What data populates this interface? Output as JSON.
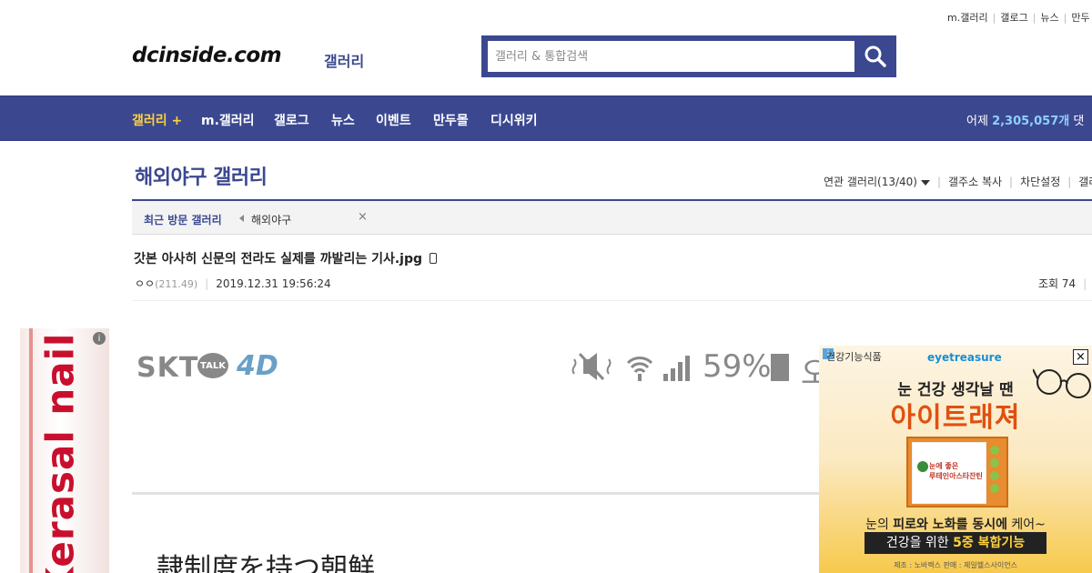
{
  "utility_links": [
    "m.갤러리",
    "갤로그",
    "뉴스",
    "만두"
  ],
  "logo": {
    "text": "dcinside.com",
    "sub": "갤러리"
  },
  "search": {
    "placeholder": "갤러리 & 통합검색",
    "icon": "search-icon"
  },
  "nav": {
    "items": [
      "갤러리 +",
      "m.갤러리",
      "갤로그",
      "뉴스",
      "이벤트",
      "만두몰",
      "디시위키"
    ],
    "stat_prefix": "어제 ",
    "stat_value": "2,305,057개",
    "stat_suffix": " 댓"
  },
  "gallery": {
    "title": "해외야구 갤러리",
    "options": [
      "연관 갤러리(13/40)",
      "갤주소 복사",
      "차단설정",
      "갤러"
    ],
    "recent_label": "최근 방문 갤러리",
    "recent_item": "해외야구",
    "recent_close": "×"
  },
  "post": {
    "title": "갓본 아사히 신문의 전라도 실제를 까발리는 기사.jpg",
    "author": "ㅇㅇ",
    "ip": "(211.49)",
    "date": "2019.12.31 19:56:24",
    "views": "조회 74"
  },
  "post_image": {
    "carrier": "SKT",
    "talk": "TALK",
    "lte": "4D",
    "battery_pct": "59%",
    "ampm": "오",
    "bottom_text": "隷制度を持つ朝鮮"
  },
  "left_ad": {
    "info": "i",
    "brand": "Kerasal nail"
  },
  "right_ad": {
    "badge": "i",
    "category": "건강기능식품",
    "brand": "eyetreasure",
    "headline": "눈 건강 생각날 땐",
    "product": "아이트래져",
    "box_text_1": "눈에 좋은",
    "box_text_2": "루테인아스타잔틴",
    "line1_pre": "눈의 ",
    "line1_bold": "피로와 노화를 동시에",
    "line1_post": " 케어~",
    "line2_pre": "건강을 위한 ",
    "line2_bold": "5중 복합기능",
    "footer": "제조 : 노바렉스   판매 : 제일헬스사이언스",
    "close": "×"
  }
}
